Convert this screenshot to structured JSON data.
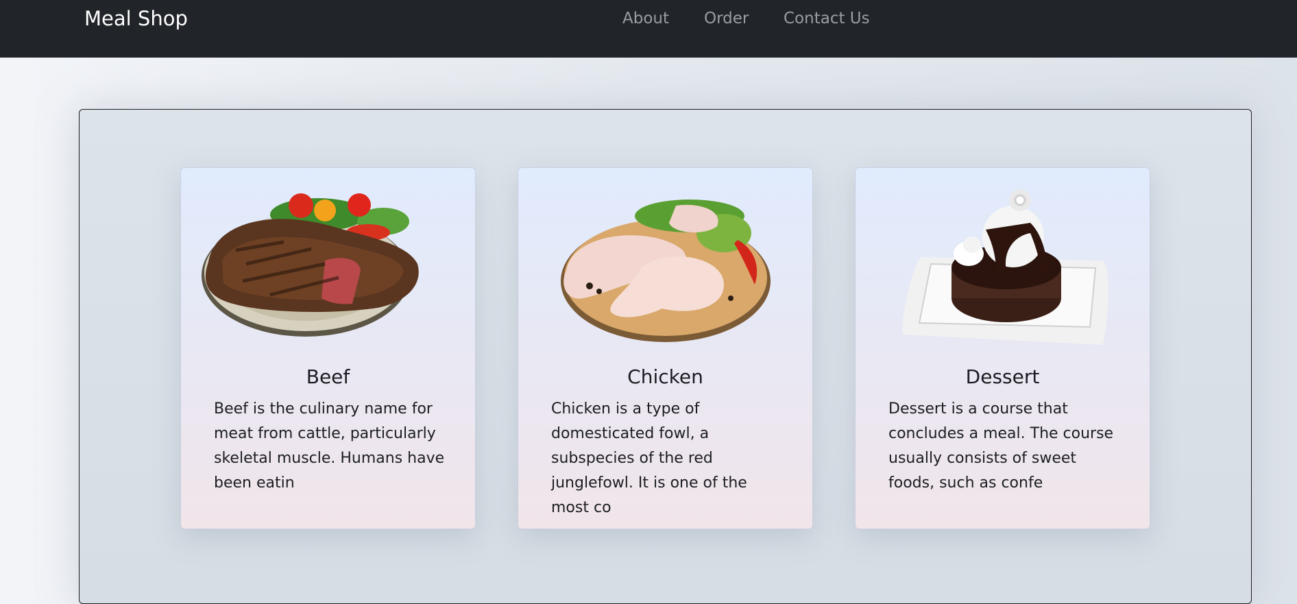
{
  "navbar": {
    "brand": "Meal Shop",
    "links": [
      "About",
      "Order",
      "Contact Us"
    ]
  },
  "cards": [
    {
      "title": "Beef",
      "text": "Beef is the culinary name for meat from cattle, particularly skeletal muscle. Humans have been eatin",
      "image_icon": "beef-steak-plate-image"
    },
    {
      "title": "Chicken",
      "text": "Chicken is a type of domesticated fowl, a subspecies of the red junglefowl. It is one of the most co",
      "image_icon": "raw-chicken-legs-board-image"
    },
    {
      "title": "Dessert",
      "text": "Dessert is a course that concludes a meal. The course usually consists of sweet foods, such as confe",
      "image_icon": "chocolate-cake-plate-image"
    }
  ],
  "colors": {
    "navbar_bg": "#212529",
    "brand_text": "#ffffff",
    "nav_link": "#9a9da1",
    "card_top": "#e0ebfd",
    "card_bottom": "#f1e5ea"
  }
}
